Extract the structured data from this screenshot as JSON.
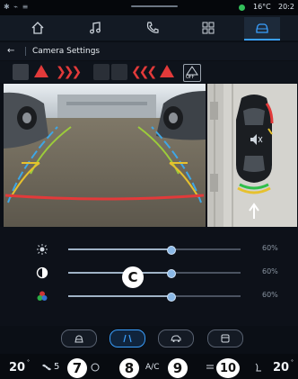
{
  "status": {
    "temperature": "16°C",
    "time": "20:2"
  },
  "nav": {
    "tabs": [
      "home",
      "music",
      "phone",
      "apps",
      "vehicle"
    ],
    "active": 4
  },
  "header": {
    "back_icon": "←",
    "title": "Camera Settings"
  },
  "sensor_strip": {
    "off_label": "OFF"
  },
  "sliders": [
    {
      "name": "brightness",
      "icon": "sun-icon",
      "value": 0.6,
      "label": "60%"
    },
    {
      "name": "contrast",
      "icon": "contrast-icon",
      "value": 0.6,
      "label": "60%"
    },
    {
      "name": "color",
      "icon": "color-icon",
      "value": 0.6,
      "label": "60%"
    }
  ],
  "mode_buttons": [
    {
      "name": "rear-view",
      "active": false
    },
    {
      "name": "rear-angle",
      "active": true
    },
    {
      "name": "side-view",
      "active": false
    },
    {
      "name": "top-view",
      "active": false
    }
  ],
  "climate": {
    "left_temp": "20",
    "left_temp_unit": "°",
    "fan_level": "5",
    "ac_label": "A/C",
    "right_temp": "20",
    "right_temp_unit": "°"
  },
  "callouts": {
    "c": "C",
    "n7": "7",
    "n8": "8",
    "n9": "9",
    "n10": "10"
  },
  "colors": {
    "accent": "#3aa0ff",
    "warning": "#e23a3a",
    "status_green": "#33c05a"
  }
}
